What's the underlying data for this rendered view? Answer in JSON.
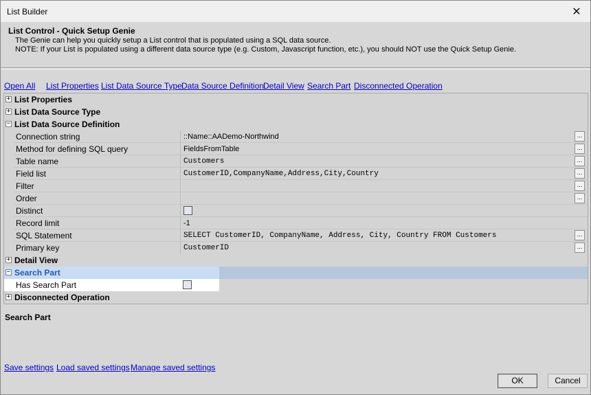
{
  "window": {
    "title": "List Builder",
    "close_glyph": "✕"
  },
  "header": {
    "title": "List Control - Quick Setup Genie",
    "line1": "The Genie can help you quickly setup a List control that is populated using a SQL data source.",
    "line2": "NOTE: If your List is populated using a different data source type (e.g. Custom, Javascript function, etc.), you should NOT use the Quick Setup Genie."
  },
  "nav": {
    "open_all": "Open All",
    "list_properties": "List Properties",
    "list_data_source_type": "List Data Source Type",
    "data_source_definition": "Data Source Definition",
    "detail_view": "Detail View",
    "search_part": "Search Part",
    "disconnected_operation": "Disconnected Operation"
  },
  "grid": {
    "categories": {
      "list_properties": "List Properties",
      "list_data_source_type": "List Data Source Type",
      "list_data_source_definition": "List Data Source Definition",
      "detail_view": "Detail View",
      "search_part": "Search Part",
      "disconnected_operation": "Disconnected Operation"
    },
    "expander": {
      "plus": "+",
      "minus": "−"
    },
    "ellipsis": "...",
    "properties": {
      "connection_string": {
        "name": "Connection string",
        "value": "::Name::AADemo-Northwind"
      },
      "method": {
        "name": "Method for defining SQL query",
        "value": "FieldsFromTable"
      },
      "table_name": {
        "name": "Table name",
        "value": "Customers"
      },
      "field_list": {
        "name": "Field list",
        "value": "CustomerID,CompanyName,Address,City,Country"
      },
      "filter": {
        "name": "Filter",
        "value": ""
      },
      "order": {
        "name": "Order",
        "value": ""
      },
      "distinct": {
        "name": "Distinct",
        "checked": false
      },
      "record_limit": {
        "name": "Record limit",
        "value": "-1"
      },
      "sql_statement": {
        "name": "SQL Statement",
        "value": "SELECT CustomerID, CompanyName, Address, City, Country FROM Customers"
      },
      "primary_key": {
        "name": "Primary key",
        "value": "CustomerID"
      },
      "has_search_part": {
        "name": "Has Search Part",
        "checked": false
      }
    }
  },
  "description": {
    "title": "Search Part"
  },
  "footer": {
    "save_settings": "Save settings",
    "load_saved_settings": "Load saved settings",
    "manage_saved_settings": "Manage saved settings",
    "ok": "OK",
    "cancel": "Cancel"
  }
}
